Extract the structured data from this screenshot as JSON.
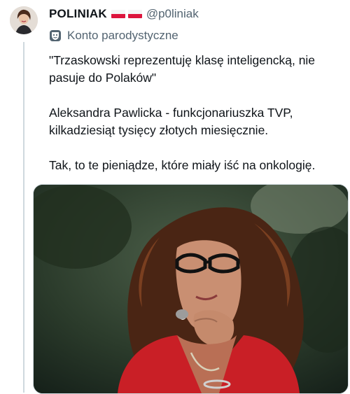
{
  "author": {
    "display_name": "POLINIAK",
    "handle": "@p0liniak",
    "flag_count": 2,
    "parody_label": "Konto parodystyczne"
  },
  "tweet": {
    "paragraphs": [
      "\"Trzaskowski reprezentuję klasę inteligencką, nie pasuje do Polaków\"",
      "Aleksandra Pawlicka - funkcjonariuszka TVP, kilkadziesiąt tysięcy złotych miesięcznie.",
      "Tak, to te pieniądze, które miały iść na onkologię."
    ]
  },
  "colors": {
    "text": "#0f1419",
    "secondary": "#536471",
    "flag_red": "#dc143c",
    "border": "#cfd9de"
  },
  "icons": {
    "parody": "theater-masks-icon"
  }
}
